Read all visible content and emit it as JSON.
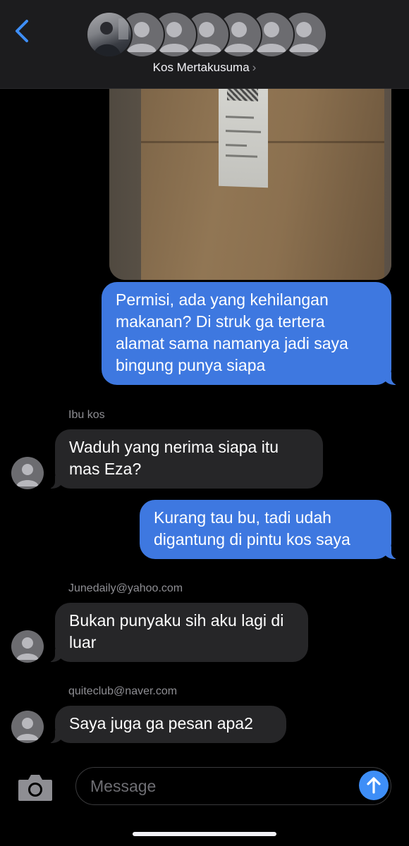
{
  "header": {
    "group_name": "Kos Mertakusuma",
    "chevron": "›",
    "back_icon": "chevron-left-icon",
    "participant_count_shown": 7
  },
  "messages": [
    {
      "type": "outgoing",
      "text": "Permisi, ada yang kehilangan makanan? Di struk ga tertera alamat sama namanya jadi saya bingung punya siapa"
    },
    {
      "type": "incoming",
      "sender": "Ibu kos",
      "text": "Waduh yang nerima siapa itu mas Eza?"
    },
    {
      "type": "outgoing",
      "text": "Kurang tau bu, tadi udah digantung di pintu kos saya"
    },
    {
      "type": "incoming",
      "sender": "Junedaily@yahoo.com",
      "text": "Bukan punyaku sih aku lagi di luar"
    },
    {
      "type": "incoming",
      "sender": "quiteclub@naver.com",
      "text": "Saya juga ga pesan apa2"
    }
  ],
  "input": {
    "placeholder": "Message",
    "camera_icon": "camera-icon",
    "send_icon": "arrow-up-icon"
  },
  "colors": {
    "outgoing_bubble": "#3e78e0",
    "incoming_bubble": "#262628",
    "accent": "#3e8ef7",
    "background": "#000000"
  }
}
